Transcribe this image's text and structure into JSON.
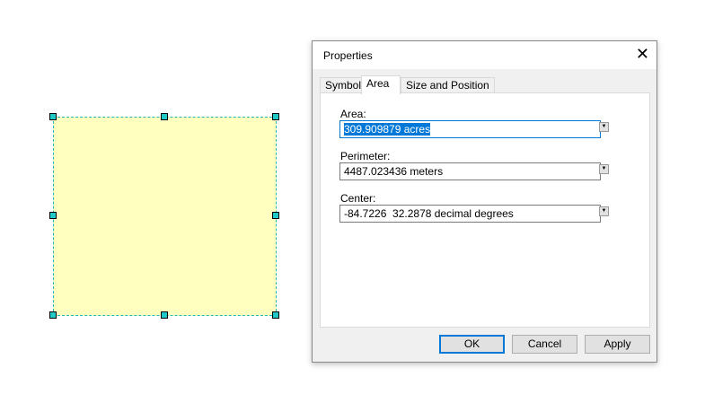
{
  "dialog": {
    "title": "Properties",
    "tabs": [
      "Symbol",
      "Area",
      "Size and Position"
    ],
    "active_tab": "Area",
    "fields": [
      {
        "label": "Area:",
        "value": "309.909879 acres"
      },
      {
        "label": "Perimeter:",
        "value": "4487.023436 meters"
      },
      {
        "label": "Center:",
        "value": "-84.7226  32.2878 decimal degrees"
      }
    ],
    "buttons": {
      "ok": "OK",
      "cancel": "Cancel",
      "apply": "Apply"
    }
  },
  "colors": {
    "polygon_fill": "#ffffc0",
    "handle": "#20c8c8",
    "accent": "#0078d7"
  }
}
